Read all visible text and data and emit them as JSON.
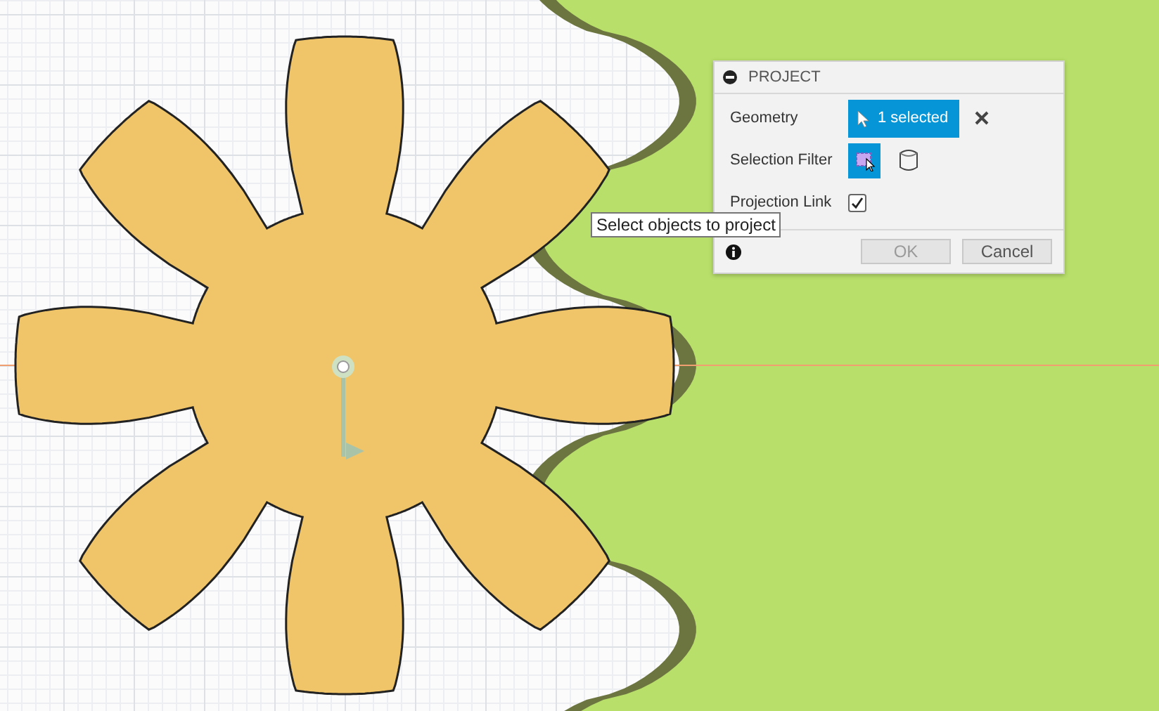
{
  "dialog": {
    "title": "PROJECT",
    "rows": [
      {
        "kind": "button",
        "label": "Geometry",
        "value": "1 selected"
      },
      {
        "kind": "filters",
        "label": "Selection Filter",
        "filters": [
          {
            "selected": true
          },
          {
            "selected": false
          }
        ]
      },
      {
        "kind": "checkbox",
        "label": "Projection Link",
        "checked": true
      }
    ],
    "buttons": [
      {
        "label": "OK",
        "disabled": true
      },
      {
        "label": "Cancel",
        "disabled": false
      }
    ]
  },
  "tooltip": "Select objects to project"
}
